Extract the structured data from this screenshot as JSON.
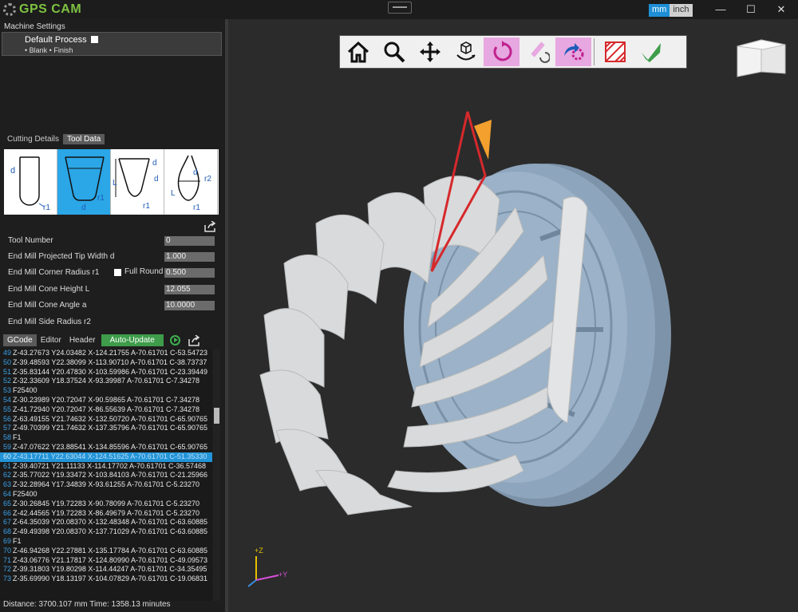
{
  "app": {
    "title": "GPS CAM"
  },
  "units": {
    "mm": "mm",
    "inch": "inch"
  },
  "window": {
    "minimize": "—",
    "maximize": "☐",
    "close": "✕"
  },
  "machine": {
    "title": "Machine Settings",
    "process": "Default Process",
    "steps": "•  Blank  •  Finish"
  },
  "tabs": {
    "cutting": "Cutting Details",
    "tool": "Tool Data"
  },
  "tool_labels": {
    "d": "d",
    "r1": "r1",
    "r2": "r2",
    "L": "L"
  },
  "params": [
    {
      "label": "Tool Number",
      "value": "0"
    },
    {
      "label": "End Mill Projected Tip Width d",
      "value": "1.000"
    },
    {
      "label": "End Mill Corner Radius r1",
      "value": "0.500"
    },
    {
      "label": "End Mill Cone Height L",
      "value": "12.055"
    },
    {
      "label": "End Mill Cone Angle a",
      "value": "10.0000"
    },
    {
      "label": "End Mill Side Radius r2",
      "value": ""
    }
  ],
  "full_round": "Full Round",
  "gtabs": {
    "gcode": "GCode",
    "editor": "Editor",
    "header": "Header",
    "auto": "Auto-Update"
  },
  "gcode": [
    {
      "n": "49",
      "t": "Z-43.27673 Y24.03482 X-124.21755 A-70.61701 C-53.54723"
    },
    {
      "n": "50",
      "t": "Z-39.48593 Y22.38099 X-113.90710 A-70.61701 C-38.73737"
    },
    {
      "n": "51",
      "t": "Z-35.83144 Y20.47830 X-103.59986 A-70.61701 C-23.39449"
    },
    {
      "n": "52",
      "t": "Z-32.33609 Y18.37524 X-93.39987 A-70.61701 C-7.34278"
    },
    {
      "n": "53",
      "t": "F25400"
    },
    {
      "n": "54",
      "t": "Z-30.23989 Y20.72047 X-90.59865 A-70.61701 C-7.34278"
    },
    {
      "n": "55",
      "t": "Z-41.72940 Y20.72047 X-86.55639 A-70.61701 C-7.34278"
    },
    {
      "n": "56",
      "t": "Z-63.49155 Y21.74632 X-132.50720 A-70.61701 C-65.90765"
    },
    {
      "n": "57",
      "t": "Z-49.70399 Y21.74632 X-137.35796 A-70.61701 C-65.90765"
    },
    {
      "n": "58",
      "t": "F1"
    },
    {
      "n": "59",
      "t": "Z-47.07622 Y23.88541 X-134.85596 A-70.61701 C-65.90765"
    },
    {
      "n": "60",
      "t": "Z-43.17711 Y22.63044 X-124.51625 A-70.61701 C-51.35330"
    },
    {
      "n": "61",
      "t": "Z-39.40721 Y21.11133 X-114.17702 A-70.61701 C-36.57468"
    },
    {
      "n": "62",
      "t": "Z-35.77022 Y19.33472 X-103.84103 A-70.61701 C-21.25966"
    },
    {
      "n": "63",
      "t": "Z-32.28964 Y17.34839 X-93.61255 A-70.61701 C-5.23270"
    },
    {
      "n": "64",
      "t": "F25400"
    },
    {
      "n": "65",
      "t": "Z-30.26845 Y19.72283 X-90.78099 A-70.61701 C-5.23270"
    },
    {
      "n": "66",
      "t": "Z-42.44565 Y19.72283 X-86.49679 A-70.61701 C-5.23270"
    },
    {
      "n": "67",
      "t": "Z-64.35039 Y20.08370 X-132.48348 A-70.61701 C-63.60885"
    },
    {
      "n": "68",
      "t": "Z-49.49398 Y20.08370 X-137.71029 A-70.61701 C-63.60885"
    },
    {
      "n": "69",
      "t": "F1"
    },
    {
      "n": "70",
      "t": "Z-46.94268 Y22.27881 X-135.17784 A-70.61701 C-63.60885"
    },
    {
      "n": "71",
      "t": "Z-43.06776 Y21.17817 X-124.80990 A-70.61701 C-49.09573"
    },
    {
      "n": "72",
      "t": "Z-39.31803 Y19.80298 X-114.44247 A-70.61701 C-34.35495"
    },
    {
      "n": "73",
      "t": "Z-35.69990 Y18.13197 X-104.07829 A-70.61701 C-19.06831"
    }
  ],
  "status": {
    "text": "Distance: 3700.107 mm    Time: 1358.13 minutes"
  },
  "axes": {
    "z": "+Z",
    "y": "+Y"
  }
}
